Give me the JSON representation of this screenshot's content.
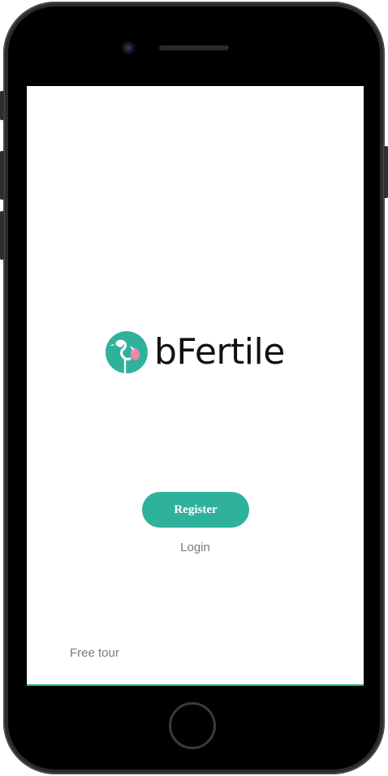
{
  "app": {
    "brand_name": "bFertile",
    "colors": {
      "accent": "#2fb29c",
      "logo_pink": "#e98aa8",
      "text_muted": "#7a7a7a"
    }
  },
  "actions": {
    "register_label": "Register",
    "login_label": "Login",
    "free_tour_label": "Free tour"
  },
  "icons": {
    "logo": "stork-logo-icon",
    "camera": "front-camera",
    "home": "home-button"
  }
}
